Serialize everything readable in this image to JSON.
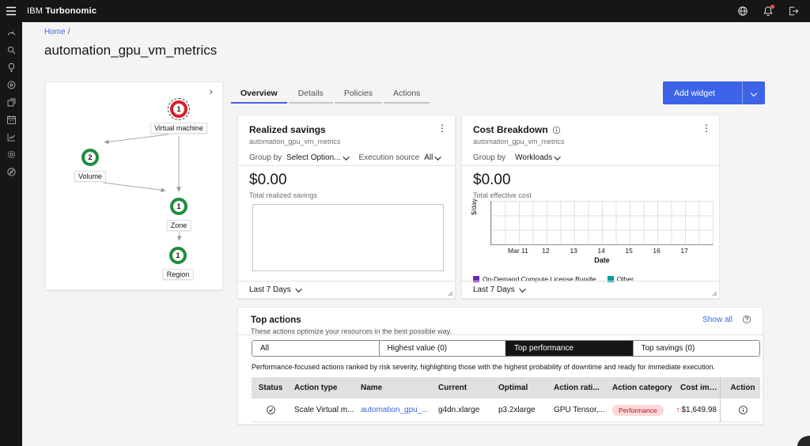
{
  "glyphs": {
    "kebab": "⋮",
    "expand": "›"
  },
  "header": {
    "brand_prefix": "IBM",
    "brand_name": "Turbonomic"
  },
  "topbar": {
    "icons": [
      "hamburger-menu",
      "globe",
      "notifications-bell-with-badge",
      "logout"
    ]
  },
  "sidebar": {
    "icons": [
      "gauge-dashboard",
      "search",
      "lightbulb-insights",
      "location-target",
      "plans-copy",
      "schedule-calendar",
      "analytics-line-chart",
      "settings-gear",
      "compass-navigate"
    ]
  },
  "breadcrumb": {
    "home": "Home",
    "separator": "/"
  },
  "page": {
    "title": "automation_gpu_vm_metrics"
  },
  "supply_chain": {
    "nodes": [
      {
        "label": "Virtual machine",
        "count": "1",
        "severity": "critical"
      },
      {
        "label": "Volume",
        "count": "2",
        "severity": "normal"
      },
      {
        "label": "Zone",
        "count": "1",
        "severity": "normal"
      },
      {
        "label": "Region",
        "count": "1",
        "severity": "normal"
      }
    ]
  },
  "tabs": [
    {
      "label": "Overview",
      "selected": true
    },
    {
      "label": "Details",
      "selected": false
    },
    {
      "label": "Policies",
      "selected": false
    },
    {
      "label": "Actions",
      "selected": false
    }
  ],
  "toolbar": {
    "add_widget_label": "Add widget"
  },
  "realized_savings": {
    "title": "Realized savings",
    "subtitle": "automation_gpu_vm_metrics",
    "group_by_label": "Group by",
    "group_by_value": "Select Option...",
    "execution_source_label": "Execution source",
    "execution_source_value": "All",
    "amount": "$0.00",
    "amount_caption": "Total realized savings",
    "time_range": "Last 7 Days"
  },
  "cost_breakdown": {
    "title": "Cost Breakdown",
    "subtitle": "automation_gpu_vm_metrics",
    "group_by_label": "Group by",
    "group_by_value": "Workloads",
    "amount": "$0.00",
    "amount_caption": "Total effective cost",
    "time_range": "Last 7 Days",
    "chart_data": {
      "type": "line",
      "x_ticks": [
        "Mar 11",
        "12",
        "13",
        "14",
        "15",
        "16",
        "17"
      ],
      "xlabel": "Date",
      "ylabel": "$/day",
      "grid": "on",
      "legend_position": "bottom",
      "series": [
        {
          "name": "On-Demand Compute License Bundle",
          "color": "#6929c4",
          "values": []
        },
        {
          "name": "Other",
          "color": "#009d9a",
          "values": []
        }
      ]
    }
  },
  "top_actions": {
    "title": "Top actions",
    "subtitle": "These actions optimize your resources in the best possible way.",
    "show_all_label": "Show all",
    "filters": [
      {
        "label": "All",
        "selected": false
      },
      {
        "label": "Highest value (0)",
        "selected": false
      },
      {
        "label": "Top performance",
        "selected": true
      },
      {
        "label": "Top savings (0)",
        "selected": false
      }
    ],
    "description": "Performance-focused actions ranked by risk severity, highlighting those with the highest probability of downtime and ready for immediate execution.",
    "table": {
      "columns": [
        "Status",
        "Action type",
        "Name",
        "Current",
        "Optimal",
        "Action rati...",
        "Action category",
        "Cost impact",
        "Action"
      ],
      "rows": [
        {
          "status_icon": "check-circle",
          "action_type": "Scale Virtual m...",
          "name": "automation_gpu_...",
          "current": "g4dn.xlarge",
          "optimal": "p3.2xlarge",
          "action_rationale": "GPU Tensor,...",
          "category": "Performance",
          "cost_impact_arrow": "↑",
          "cost_impact": "$1,649.98"
        }
      ]
    }
  },
  "colors": {
    "accent_blue": "#3d63e8",
    "critical_red": "#da1e28",
    "healthy_green": "#1e8e3e",
    "badge_bg": "#ffd7d9",
    "badge_text": "#a2191f",
    "legend_purple": "#6929c4",
    "legend_teal": "#009d9a",
    "header_bg": "#161616"
  }
}
